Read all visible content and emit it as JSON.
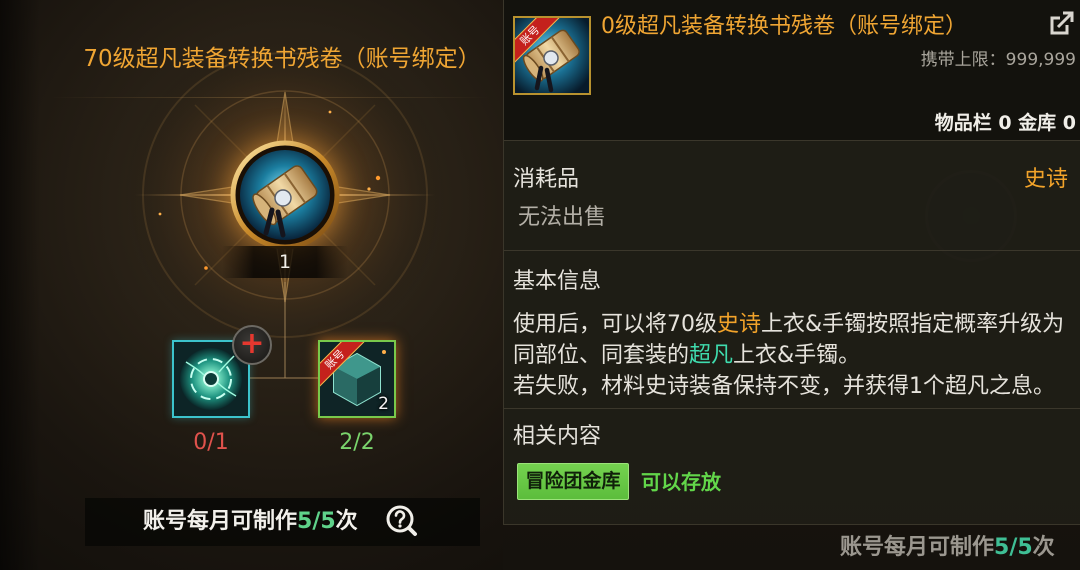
{
  "colors": {
    "title_orange": "#efa533",
    "rarity_orange": "#f2a32a",
    "progress_red": "#e0524c",
    "progress_green": "#7ad46c",
    "button_green": "#5cbd3c",
    "store_green": "#62d64a",
    "tooltip_text": "#e6e3dc",
    "muted_text": "#b3afa6"
  },
  "craft_panel": {
    "title": "70级超凡装备转换书残卷（账号绑定）",
    "result_item": {
      "icon": "scroll-icon",
      "quantity": "1"
    },
    "materials": [
      {
        "icon": "teal-orb-icon",
        "badge_icon": "add-icon",
        "badge_symbol": "+",
        "progress": "0/1"
      },
      {
        "icon": "gem-icon",
        "ribbon": "账号",
        "stack_count": "2",
        "progress": "2/2"
      }
    ],
    "monthly_limit": {
      "segments": [
        {
          "text": "账号每月可制作"
        },
        {
          "text": "5/5",
          "color": "#5fd28a"
        },
        {
          "text": "次"
        }
      ],
      "help_icon": "help-icon"
    }
  },
  "tooltip": {
    "icon": "scroll-icon",
    "icon_ribbon": "账号",
    "title": "0级超凡装备转换书残卷（账号绑定）",
    "share_icon": "share-icon",
    "carry_limit": "携带上限：999,999",
    "storage": "物品栏 0 金库 0",
    "category": "消耗品",
    "rarity": "史诗",
    "sell_status": "无法出售",
    "basic_info_heading": "基本信息",
    "description": [
      [
        {
          "text": "使用后，可以将70级"
        },
        {
          "text": "史诗",
          "color": "#f2a32a"
        },
        {
          "text": "上衣&手镯按照指定概率升级为"
        }
      ],
      [
        {
          "text": "同部位、同套装的"
        },
        {
          "text": "超凡",
          "color": "#3fdcae"
        },
        {
          "text": "上衣&手镯。"
        }
      ],
      [
        {
          "text": "若失败，材料史诗装备保持不变，并获得1个超凡之息。"
        }
      ]
    ],
    "related_heading": "相关内容",
    "related": {
      "button_label": "冒险团金库",
      "status": "可以存放"
    }
  },
  "background_panel": {
    "monthly_limit": [
      {
        "text": "账号每月可制作"
      },
      {
        "text": "5/5",
        "color": "#3fbf95"
      },
      {
        "text": "次"
      }
    ]
  }
}
